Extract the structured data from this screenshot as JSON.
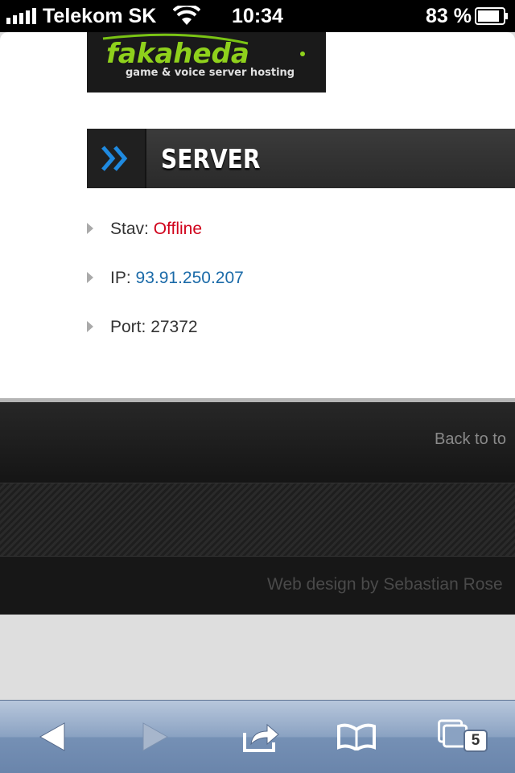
{
  "status_bar": {
    "carrier": "Telekom SK",
    "time": "10:34",
    "battery_percent": "83 %"
  },
  "logo": {
    "brand": "fakaheda",
    "tagline": "game & voice server hosting"
  },
  "section": {
    "title": "SERVER"
  },
  "server_info": {
    "status_label": "Stav: ",
    "status_value": "Offline",
    "ip_label": "IP: ",
    "ip_value": "93.91.250.207",
    "port_label": "Port: ",
    "port_value": "27372"
  },
  "footer": {
    "back_to_top": "Back to to",
    "credit": "Web design by Sebastian Rose"
  },
  "toolbar": {
    "tabs_count": "5"
  },
  "colors": {
    "status_offline": "#d0021b",
    "link": "#1a6aa8",
    "accent_blue": "#1f8ae0"
  }
}
